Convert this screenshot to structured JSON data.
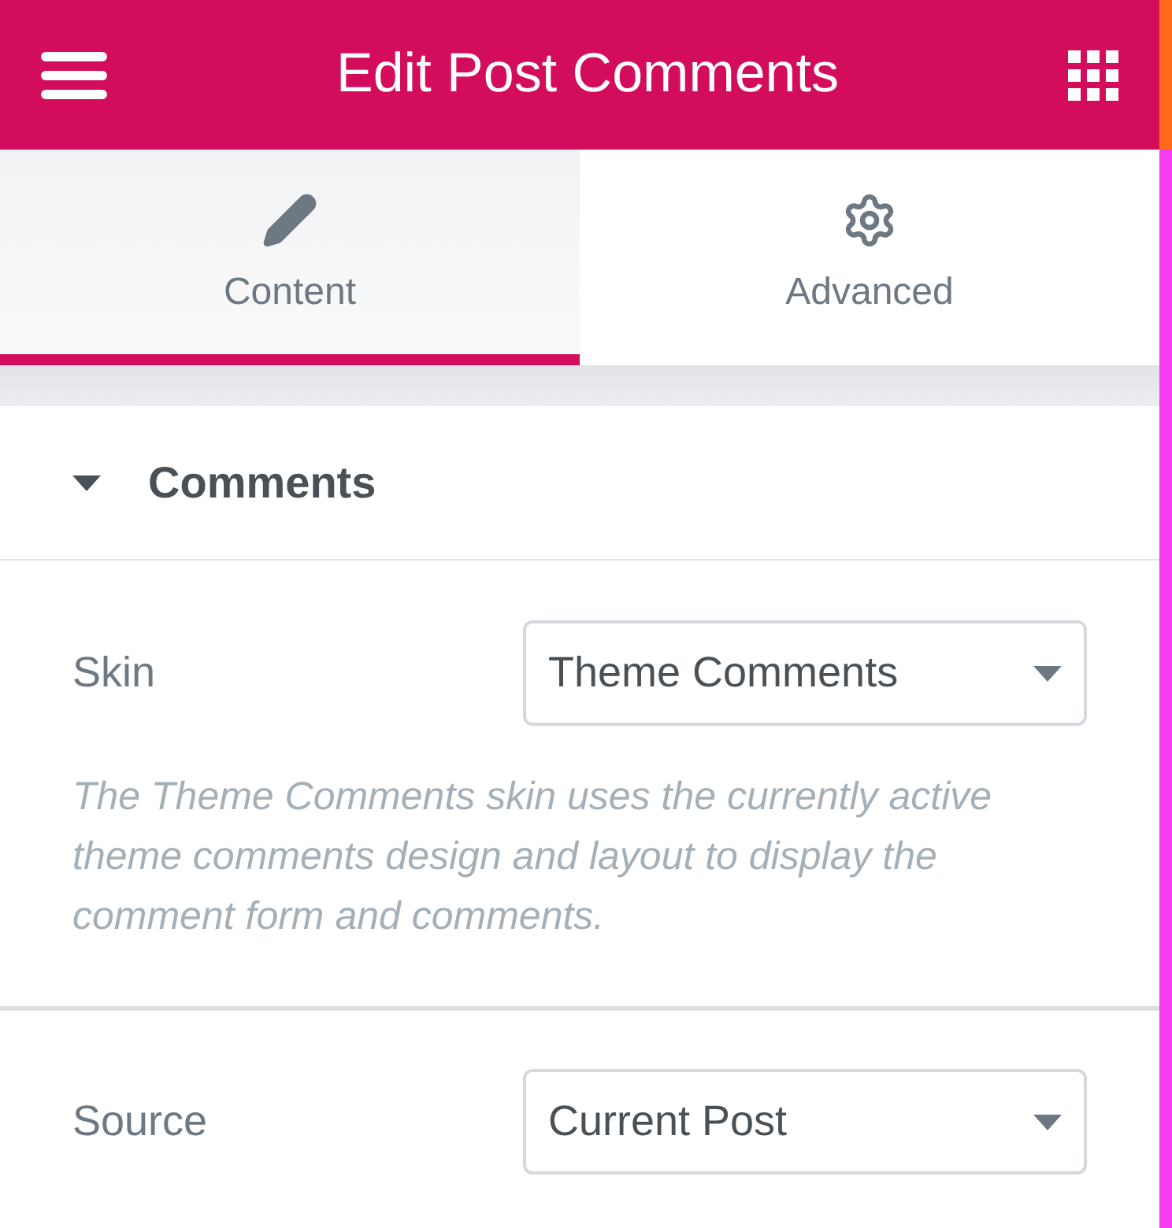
{
  "header": {
    "title": "Edit Post Comments"
  },
  "tabs": [
    {
      "label": "Content",
      "selected": true
    },
    {
      "label": "Advanced",
      "selected": false
    }
  ],
  "section": {
    "title": "Comments",
    "expanded": true
  },
  "controls": [
    {
      "label": "Skin",
      "value": "Theme Comments",
      "description": "The Theme Comments skin uses the currently active theme comments design and layout to display the comment form and comments."
    },
    {
      "label": "Source",
      "value": "Current Post"
    }
  ]
}
